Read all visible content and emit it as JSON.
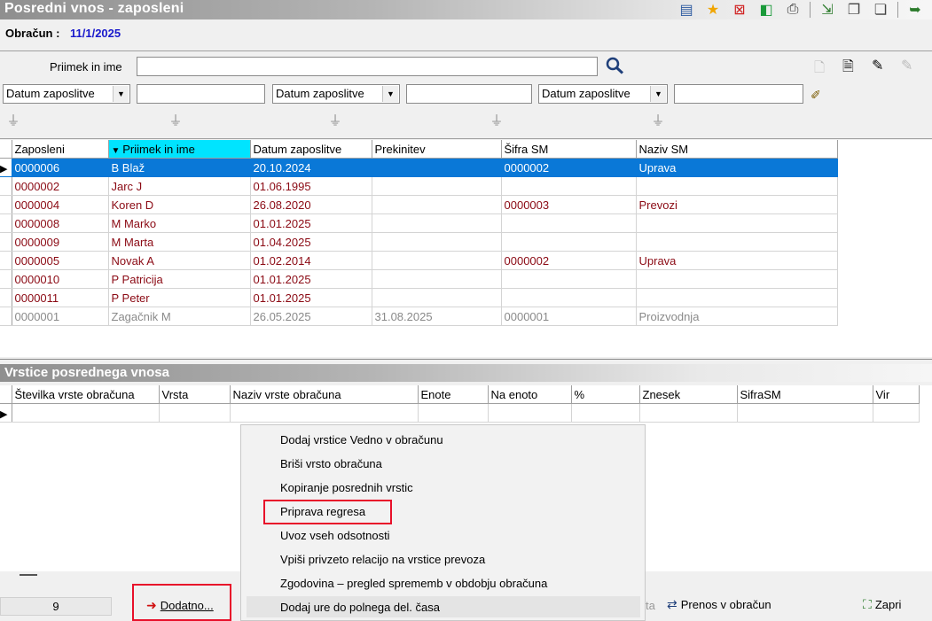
{
  "window": {
    "title": "Posredni vnos - zaposleni"
  },
  "obracun": {
    "label": "Obračun :",
    "value": "11/1/2025"
  },
  "filters": {
    "search_label": "Priimek in ime",
    "search_value": "",
    "combo1": "Datum zaposlitve",
    "combo2": "Datum zaposlitve",
    "combo3": "Datum zaposlitve"
  },
  "employees": {
    "columns": [
      "Zaposleni",
      "Priimek in ime",
      "Datum zaposlitve",
      "Prekinitev",
      "Šifra SM",
      "Naziv SM"
    ],
    "sorted_column": "Priimek in ime",
    "rows": [
      [
        "0000006",
        "B Blaž",
        "20.10.2024",
        "",
        "0000002",
        "Uprava"
      ],
      [
        "0000002",
        "Jarc J",
        "01.06.1995",
        "",
        "",
        ""
      ],
      [
        "0000004",
        "Koren D",
        "26.08.2020",
        "",
        "0000003",
        "Prevozi"
      ],
      [
        "0000008",
        "M Marko",
        "01.01.2025",
        "",
        "",
        ""
      ],
      [
        "0000009",
        "M Marta",
        "01.04.2025",
        "",
        "",
        ""
      ],
      [
        "0000005",
        "Novak A",
        "01.02.2014",
        "",
        "0000002",
        "Uprava"
      ],
      [
        "0000010",
        "P Patricija",
        "01.01.2025",
        "",
        "",
        ""
      ],
      [
        "0000011",
        "P Peter",
        "01.01.2025",
        "",
        "",
        ""
      ],
      [
        "0000001",
        "Zagačnik M",
        "26.05.2025",
        "31.08.2025",
        "0000001",
        "Proizvodnja"
      ]
    ],
    "selected_row": 0,
    "inactive_row": 8
  },
  "lines_section": {
    "title": "Vrstice posrednega vnosa",
    "columns": [
      "Številka vrste obračuna",
      "Vrsta",
      "Naziv vrste obračuna",
      "Enote",
      "Na enoto",
      "%",
      "Znesek",
      "SifraSM",
      "Vir"
    ]
  },
  "context_menu": {
    "items": [
      "Dodaj vrstice Vedno v obračunu",
      "Briši vrsto obračuna",
      "Kopiranje posrednih vrstic",
      "Priprava regresa",
      "Uvoz vseh odsotnosti",
      "Vpiši privzeto relacijo na vrstice prevoza",
      "Zgodovina – pregled sprememb v obdobju obračuna",
      "Dodaj ure do polnega del. časa"
    ],
    "highlighted_item": "Priprava regresa",
    "hovered_item": "Dodaj ure do polnega del. časa"
  },
  "bottom": {
    "count": "9",
    "dodatno": "Dodatno...",
    "partial": "ta",
    "prenos": "Prenos v obračun",
    "zapri": "Zapri"
  },
  "colors": {
    "selection": "#0a78d7",
    "sorted_header": "#00e4ff",
    "row_text": "#8b0a14",
    "highlight_box": "#e8102a",
    "obracun_value": "#1a1acc"
  }
}
